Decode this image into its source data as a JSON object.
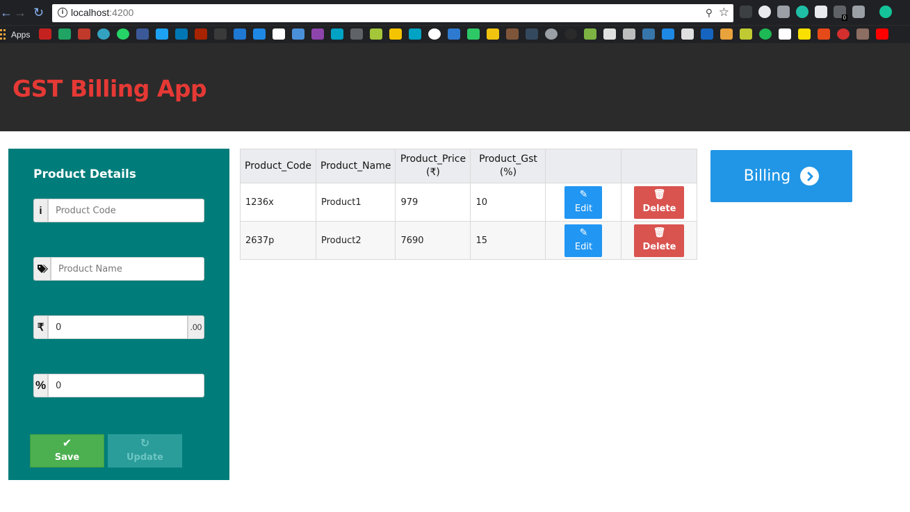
{
  "browser": {
    "url_host": "localhost",
    "url_port": ":4200",
    "bookmarks_apps_label": "Apps",
    "extension_badge": "0"
  },
  "header": {
    "title": "GST Billing App",
    "title_color": "#e53935"
  },
  "form": {
    "title": "Product Details",
    "code_placeholder": "Product Code",
    "name_placeholder": "Product Name",
    "price_value": "0",
    "price_prefix": "₹",
    "price_suffix": ".00",
    "gst_value": "0",
    "gst_prefix": "%",
    "save_label": "Save",
    "update_label": "Update"
  },
  "table": {
    "headers": [
      "Product_Code",
      "Product_Name",
      "Product_Price (₹)",
      "Product_Gst (%)",
      "",
      ""
    ],
    "rows": [
      {
        "code": "1236x",
        "name": "Product1",
        "price": "979",
        "gst": "10",
        "edit_label": "Edit",
        "delete_label": "Delete"
      },
      {
        "code": "2637p",
        "name": "Product2",
        "price": "7690",
        "gst": "15",
        "edit_label": "Edit",
        "delete_label": "Delete"
      }
    ]
  },
  "billing_button": {
    "label": "Billing"
  },
  "icons": {
    "info": "info-icon",
    "tags": "tags-icon",
    "rupee": "rupee-icon",
    "percent": "percent-icon",
    "check": "check-icon",
    "refresh": "refresh-icon",
    "edit": "edit-icon",
    "trash": "trash-icon",
    "chevron": "chevron-right-circle-icon"
  },
  "colors": {
    "panel": "#007d7a",
    "save": "#4caf50",
    "edit": "#2196f3",
    "delete": "#d9534f",
    "billing": "#2196e6"
  }
}
